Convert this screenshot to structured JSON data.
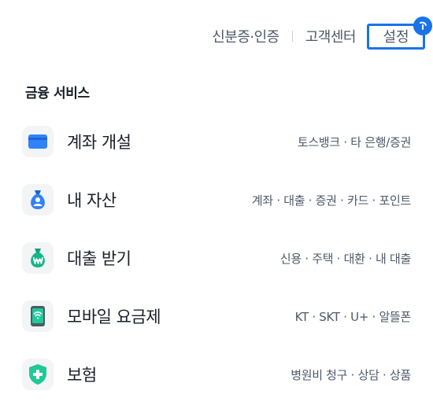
{
  "topnav": {
    "id_auth": "신분증·인증",
    "support": "고객센터",
    "settings": "설정"
  },
  "section": {
    "title": "금융 서비스"
  },
  "items": [
    {
      "title": "계좌 개설",
      "desc": "토스뱅크 · 타 은행/증권",
      "icon": "card-icon"
    },
    {
      "title": "내 자산",
      "desc": "계좌 · 대출 · 증권 · 카드 · 포인트",
      "icon": "money-bag-person-icon"
    },
    {
      "title": "대출 받기",
      "desc": "신용 · 주택 · 대환 · 내 대출",
      "icon": "money-bag-won-icon"
    },
    {
      "title": "모바일 요금제",
      "desc": "KT · SKT · U+ · 알뜰폰",
      "icon": "phone-wifi-icon"
    },
    {
      "title": "보험",
      "desc": "병원비 청구 · 상담 · 상품",
      "icon": "shield-plus-icon"
    }
  ],
  "colors": {
    "accent_blue": "#1a73e8",
    "card_blue": "#3182f6",
    "bag_green": "#12b886",
    "shield_green": "#20c997"
  }
}
